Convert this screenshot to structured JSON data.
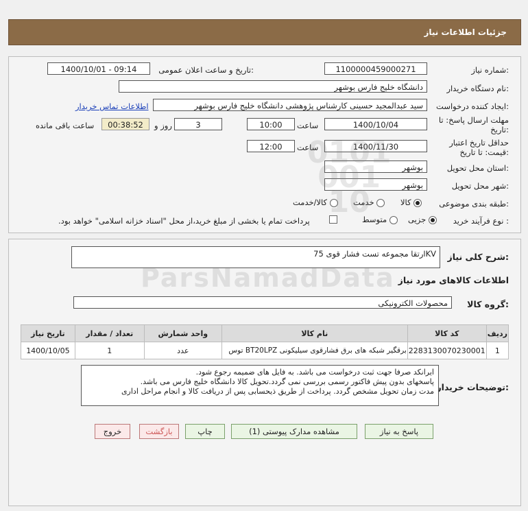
{
  "header": {
    "title": "جزئیات اطلاعات نیاز"
  },
  "form": {
    "need_number_label": "شماره نیاز:",
    "need_number": "1100000459000271",
    "announce_label": "تاریخ و ساعت اعلان عمومی:",
    "announce_value": "1400/10/01 - 09:14",
    "buyer_org_label": "نام دستگاه خریدار:",
    "buyer_org": "دانشگاه خلیج فارس بوشهر",
    "creator_label": "ایجاد کننده درخواست:",
    "creator": "سید عبدالمجید  حسینی کارشناس پژوهشی دانشگاه خلیج فارس بوشهر",
    "contact_link": "اطلاعات تماس خریدار",
    "reply_deadline_label_1": "مهلت ارسال پاسخ: تا",
    "reply_deadline_label_2": "تاریخ:",
    "reply_date": "1400/10/04",
    "time_label": "ساعت",
    "reply_time": "10:00",
    "days": "3",
    "days_label": "روز و",
    "remaining": "00:38:52",
    "remaining_label": "ساعت باقی مانده",
    "validity_label_1": "حداقل تاریخ اعتبار",
    "validity_label_2": "قیمت: تا تاریخ:",
    "validity_date": "1400/11/30",
    "validity_time": "12:00",
    "delivery_province_label": "استان محل تحویل:",
    "delivery_province": "بوشهر",
    "delivery_city_label": "شهر محل تحویل:",
    "delivery_city": "بوشهر",
    "category_label": "طبقه بندی موضوعی:",
    "category_options": [
      "کالا",
      "خدمت",
      "کالا/خدمت"
    ],
    "process_label": "نوع فرآیند خرید :",
    "process_options": [
      "جزیی",
      "متوسط"
    ],
    "treasury_text": "پرداخت تمام یا بخشی از مبلغ خرید،از محل \"اسناد خزانه اسلامی\" خواهد بود."
  },
  "summary": {
    "title_label": "شرح کلی نیاز:",
    "title_value": "ارتقا مجموعه تست فشار قوی 75KV",
    "goods_section_title": "اطلاعات کالاهای مورد نیاز",
    "goods_group_label": "گروه کالا:",
    "goods_group_value": "محصولات الکترونیکی"
  },
  "table": {
    "headers": [
      "ردیف",
      "کد کالا",
      "نام کالا",
      "واحد شمارش",
      "تعداد / مقدار",
      "تاریخ نیاز"
    ],
    "rows": [
      [
        "1",
        "2283130070230001",
        "برقگیر شبکه های برق فشارقوی سیلیکونی BT20LPZ توس",
        "عدد",
        "1",
        "1400/10/05"
      ]
    ]
  },
  "notes": {
    "label": "توضیحات خریدار:",
    "lines": [
      "ایرانکد صرفا جهت ثبت درخواست می باشد. به فایل های ضمیمه رجوع شود.",
      "پاسخهای بدون پیش فاکتور رسمی بررسی نمی گردد.تحویل کالا دانشگاه خلیج فارس می باشد.",
      "مدت زمان تحویل مشخص گردد. پرداخت از طریق ذیحسابی پس از دریافت کالا و انجام مراحل اداری"
    ]
  },
  "buttons": {
    "reply": "پاسخ به نیاز",
    "attachments": "مشاهده مدارک پیوستی (1)",
    "print": "چاپ",
    "back": "بازگشت",
    "exit": "خروج"
  },
  "colors": {
    "header_bg": "#8b6b47",
    "link": "#1a3fb8",
    "button_bg": "#eaf5e4"
  }
}
